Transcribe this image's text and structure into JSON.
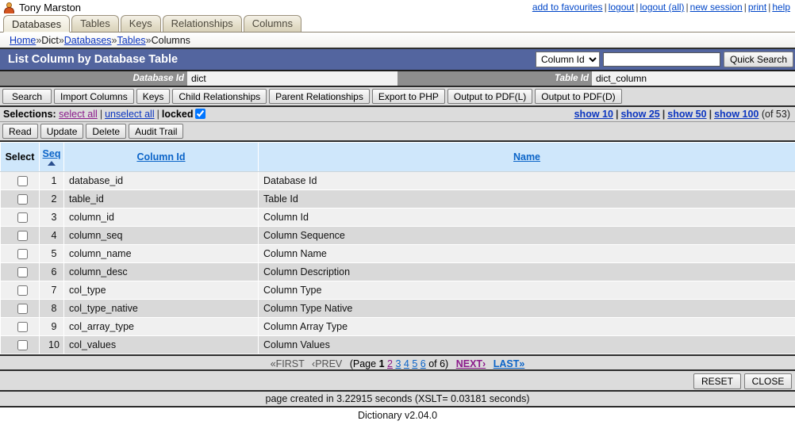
{
  "header": {
    "username": "Tony Marston",
    "avatar_icon": "user-avatar-icon",
    "links": [
      {
        "label": "add to favourites"
      },
      {
        "label": "logout"
      },
      {
        "label": "logout (all)"
      },
      {
        "label": "new session"
      },
      {
        "label": "print"
      },
      {
        "label": "help"
      }
    ],
    "link_separator": "|"
  },
  "tabs": [
    {
      "label": "Databases",
      "active": true
    },
    {
      "label": "Tables",
      "active": false
    },
    {
      "label": "Keys",
      "active": false
    },
    {
      "label": "Relationships",
      "active": false
    },
    {
      "label": "Columns",
      "active": false
    }
  ],
  "breadcrumb": {
    "separator": "»",
    "items": [
      {
        "label": "Home",
        "link": true
      },
      {
        "label": "Dict",
        "link": false
      },
      {
        "label": "Databases",
        "link": true
      },
      {
        "label": "Tables",
        "link": true
      },
      {
        "label": "Columns",
        "link": false
      }
    ]
  },
  "titlebar": {
    "title": "List Column by Database Table",
    "search_field_selected": "Column Id",
    "search_field_options": [
      "Column Id",
      "Name"
    ],
    "search_value": "",
    "search_placeholder": "",
    "search_button": "Quick Search",
    "dropdown_icon": "chevron-down-icon"
  },
  "keyfields": [
    {
      "label": "Database Id",
      "value": "dict"
    },
    {
      "label": "Table Id",
      "value": "dict_column"
    }
  ],
  "toolbar": [
    {
      "label": "Search"
    },
    {
      "label": "Import Columns"
    },
    {
      "label": "Keys"
    },
    {
      "label": "Child Relationships"
    },
    {
      "label": "Parent Relationships"
    },
    {
      "label": "Export to PHP"
    },
    {
      "label": "Output to PDF(L)"
    },
    {
      "label": "Output to PDF(D)"
    }
  ],
  "selections": {
    "label": "Selections:",
    "select_all": "select all",
    "unselect_all": "unselect all",
    "locked_label": "locked",
    "locked_checked": true,
    "separator": "|",
    "show_links": [
      {
        "label": "show 10"
      },
      {
        "label": "show 25"
      },
      {
        "label": "show 50"
      },
      {
        "label": "show 100"
      }
    ],
    "total_count": "(of 53)"
  },
  "rowactions": [
    {
      "label": "Read"
    },
    {
      "label": "Update"
    },
    {
      "label": "Delete"
    },
    {
      "label": "Audit Trail"
    }
  ],
  "grid": {
    "columns": [
      {
        "key": "select",
        "label": "Select",
        "sortable": false
      },
      {
        "key": "seq",
        "label": "Seq",
        "sortable": true,
        "sorted": "asc"
      },
      {
        "key": "column_id",
        "label": "Column Id",
        "sortable": true
      },
      {
        "key": "name",
        "label": "Name",
        "sortable": true
      }
    ],
    "rows": [
      {
        "seq": "1",
        "column_id": "database_id",
        "name": "Database Id",
        "checked": false
      },
      {
        "seq": "2",
        "column_id": "table_id",
        "name": "Table Id",
        "checked": false
      },
      {
        "seq": "3",
        "column_id": "column_id",
        "name": "Column Id",
        "checked": false
      },
      {
        "seq": "4",
        "column_id": "column_seq",
        "name": "Column Sequence",
        "checked": false
      },
      {
        "seq": "5",
        "column_id": "column_name",
        "name": "Column Name",
        "checked": false
      },
      {
        "seq": "6",
        "column_id": "column_desc",
        "name": "Column Description",
        "checked": false
      },
      {
        "seq": "7",
        "column_id": "col_type",
        "name": "Column Type",
        "checked": false
      },
      {
        "seq": "8",
        "column_id": "col_type_native",
        "name": "Column Type Native",
        "checked": false
      },
      {
        "seq": "9",
        "column_id": "col_array_type",
        "name": "Column Array Type",
        "checked": false
      },
      {
        "seq": "10",
        "column_id": "col_values",
        "name": "Column Values",
        "checked": false
      }
    ]
  },
  "pagination": {
    "first": "«FIRST",
    "prev": "‹PREV",
    "page_prefix": "(Page",
    "current_page": "1",
    "pages": [
      {
        "label": "2",
        "visited": true
      },
      {
        "label": "3",
        "visited": false
      },
      {
        "label": "4",
        "visited": false
      },
      {
        "label": "5",
        "visited": false
      },
      {
        "label": "6",
        "visited": false
      }
    ],
    "of_text": "of 6)",
    "next": "NEXT›",
    "last": "LAST»"
  },
  "bottombar": [
    {
      "label": "RESET"
    },
    {
      "label": "CLOSE"
    }
  ],
  "status": "page created in 3.22915 seconds (XSLT= 0.03181 seconds)",
  "footer": "Dictionary v2.04.0",
  "colors": {
    "titlebar_bg": "#53659f",
    "grid_header_bg": "#cfe7fb",
    "row_odd_bg": "#f0f0f0",
    "row_even_bg": "#d9d9d9",
    "link_blue": "#0b35c0",
    "link_visited": "#8b1a8b",
    "toolbar_bg": "#dcdcdc"
  }
}
